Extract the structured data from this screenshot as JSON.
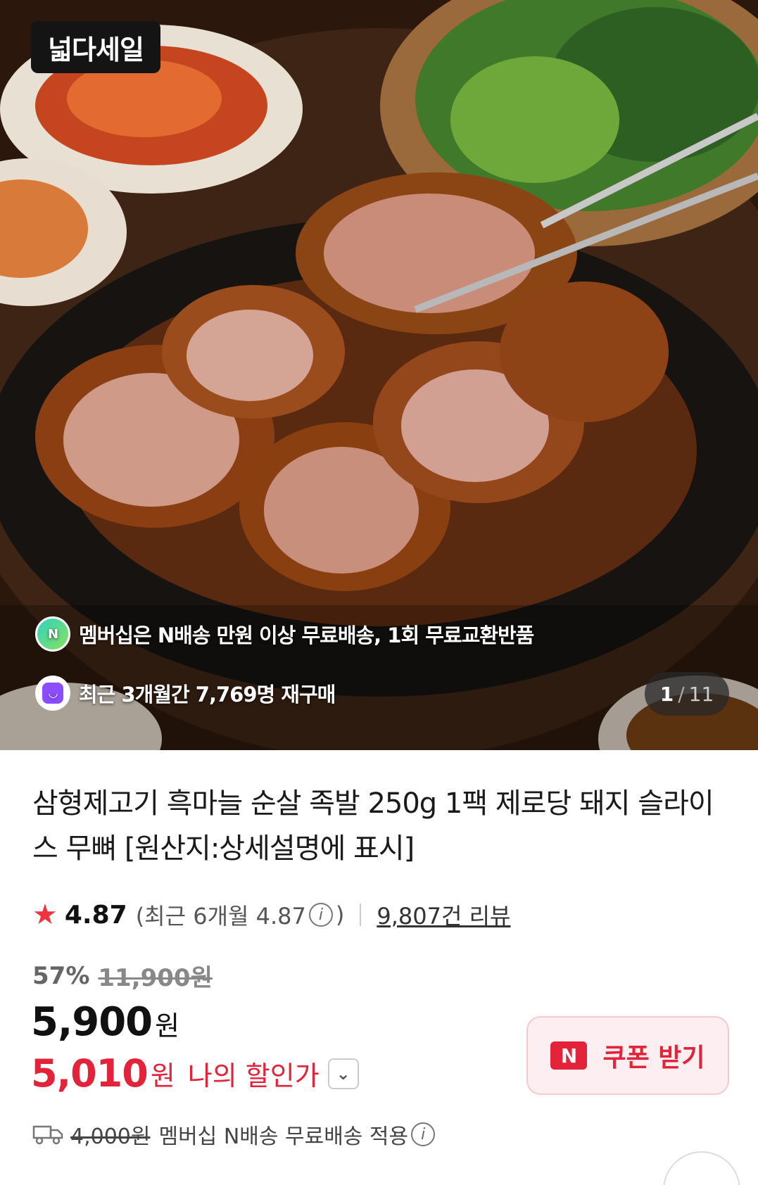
{
  "hero": {
    "brand_badge": "넓다세일",
    "promo_membership": "멤버십은 N배송 만원 이상 무료배송, 1회 무료교환반품",
    "promo_repurchase": "최근 3개월간 7,769명 재구매",
    "page_current": "1",
    "page_total": "11"
  },
  "product": {
    "title": "삼형제고기 흑마늘 순살 족발 250g 1팩 제로당 돼지 슬라이스 무뼈 [원산지:상세설명에 표시]",
    "rating": "4.87",
    "rating_recent_prefix": "(최근 6개월 4.87",
    "rating_recent_suffix": ")",
    "review_count": "9,807건 리뷰",
    "discount_rate": "57%",
    "original_price": "11,900원",
    "price": "5,900",
    "price_unit": "원",
    "my_price": "5,010",
    "my_price_unit": "원",
    "my_price_label": "나의 할인가",
    "coupon_label": "쿠폰 받기",
    "shipping_fee": "4,000원",
    "shipping_text": "멤버십 N배송 무료배송 적용"
  },
  "icons": {
    "star": "star-icon",
    "info": "info-icon",
    "chevron": "chevron-down-icon",
    "truck": "truck-icon",
    "share": "share-icon",
    "npay": "npay-logo-icon"
  },
  "colors": {
    "accent_red": "#e3233a",
    "star_red": "#ef3340",
    "coupon_bg": "#fdeef1"
  }
}
